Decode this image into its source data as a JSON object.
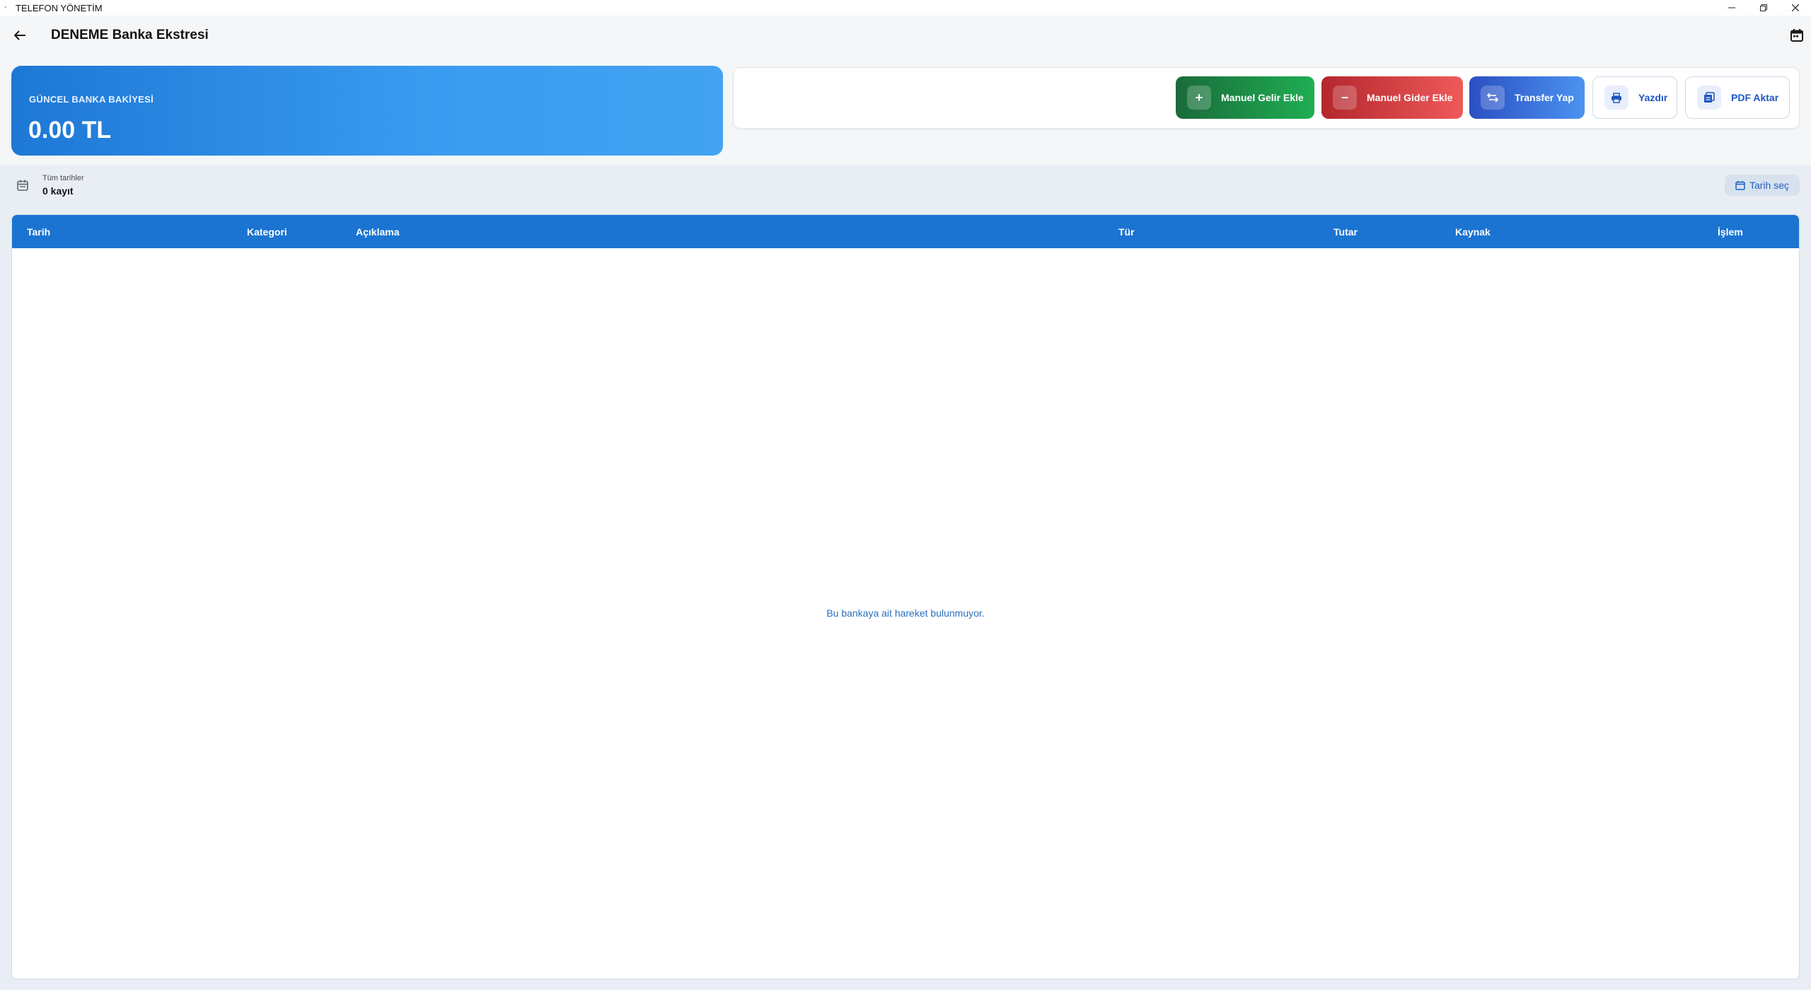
{
  "window": {
    "title": "TELEFON YÖNETİM",
    "controls": {
      "minimize": "—",
      "restore": "❐",
      "close": "✕"
    }
  },
  "appbar": {
    "title": "DENEME Banka Ekstresi"
  },
  "balance": {
    "label": "GÜNCEL BANKA BAKİYESİ",
    "value": "0.00 TL"
  },
  "actions": {
    "income": {
      "label": "Manuel Gelir Ekle",
      "icon": "plus-icon"
    },
    "expense": {
      "label": "Manuel Gider Ekle",
      "icon": "minus-icon"
    },
    "transfer": {
      "label": "Transfer Yap",
      "icon": "swap-icon"
    },
    "print": {
      "label": "Yazdır",
      "icon": "printer-icon"
    },
    "pdf": {
      "label": "PDF Aktar",
      "icon": "pdf-icon"
    }
  },
  "filter": {
    "range_label": "Tüm tarihler",
    "count_label": "0 kayıt",
    "date_button": "Tarih seç"
  },
  "table": {
    "columns": [
      "Tarih",
      "Kategori",
      "Açıklama",
      "Tür",
      "Tutar",
      "Kaynak",
      "İşlem"
    ],
    "rows": [],
    "empty_message": "Bu bankaya ait hareket bulunmuyor."
  },
  "colors": {
    "primary": "#1b74d1",
    "income": "#1fae52",
    "expense": "#ef5a5a",
    "transfer": "#4b93f0"
  }
}
